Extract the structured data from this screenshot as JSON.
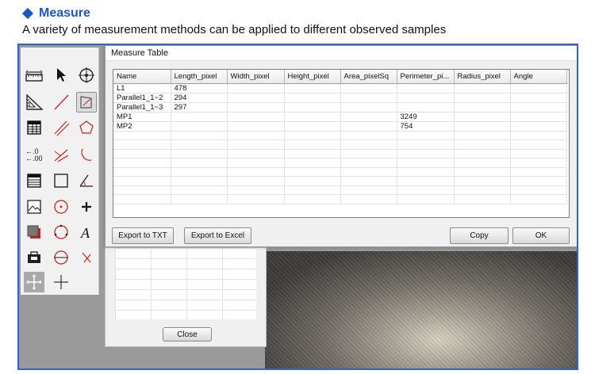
{
  "header": {
    "title": "Measure",
    "subtitle": "A variety of measurement methods can be applied to different observed samples"
  },
  "measure_window": {
    "title": "Measure Table",
    "columns": [
      "Name",
      "Length_pixel",
      "Width_pixel",
      "Height_pixel",
      "Area_pixelSq",
      "Perimeter_pi...",
      "Radius_pixel",
      "Angle"
    ],
    "rows": [
      [
        "L1",
        "478",
        "",
        "",
        "",
        "",
        "",
        ""
      ],
      [
        "Parallel1_1~2",
        "294",
        "",
        "",
        "",
        "",
        "",
        ""
      ],
      [
        "Parallel1_1~3",
        "297",
        "",
        "",
        "",
        "",
        "",
        ""
      ],
      [
        "MP1",
        "",
        "",
        "",
        "",
        "3249",
        "",
        ""
      ],
      [
        "MP2",
        "",
        "",
        "",
        "",
        "754",
        "",
        ""
      ]
    ],
    "buttons": {
      "export_txt": "Export to TXT",
      "export_excel": "Export to Excel",
      "copy": "Copy",
      "ok": "OK"
    }
  },
  "back_dialog": {
    "close_label": "Close"
  },
  "tools": [
    "ruler-calibrate-icon",
    "cursor-arrow-icon",
    "crosshair-circle-icon",
    "ruler-angle-icon",
    "line-icon",
    "polygon-select-icon",
    "table-grid-icon",
    "parallel-lines-icon",
    "pentagon-icon",
    "decimal-places-icon",
    "angle-lines-icon",
    "arc-icon",
    "table-view-icon",
    "rectangle-icon",
    "angle-measure-icon",
    "image-icon",
    "circle-center-icon",
    "point-icon",
    "layer-icon",
    "three-point-circle-icon",
    "text-icon",
    "camera-icon",
    "circle-diameter-icon",
    "intersection-icon",
    "move-icon",
    "cross-line-icon"
  ],
  "colors": {
    "accent": "#1a56c4",
    "frame": "#2b63d6",
    "tool_red": "#cc1f1f"
  }
}
